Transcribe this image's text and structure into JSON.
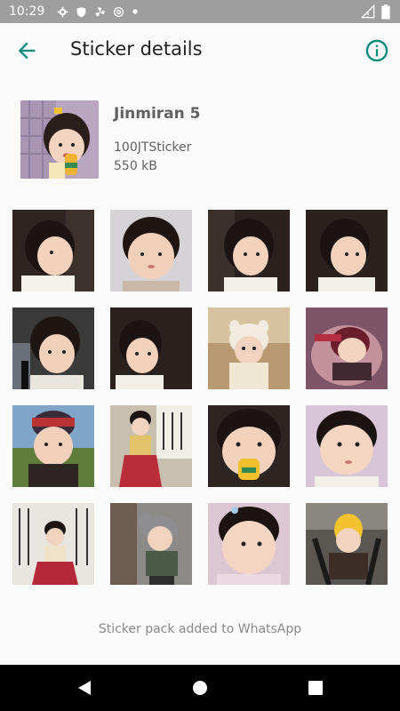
{
  "status_bar": {
    "time": "10:29",
    "left_icons": [
      "settings-icon",
      "shield-icon",
      "fan-icon",
      "at-icon",
      "dot-icon"
    ],
    "right_icons": [
      "signal-icon",
      "battery-icon"
    ]
  },
  "app_bar": {
    "title": "Sticker details",
    "back_icon": "arrow-back-icon",
    "info_icon": "info-icon",
    "accent_color": "#00897b"
  },
  "pack": {
    "name": "Jinmiran 5",
    "publisher": "100JTSticker",
    "size": "550 kB"
  },
  "stickers": [
    {
      "row": 1,
      "col": 1
    },
    {
      "row": 1,
      "col": 2
    },
    {
      "row": 1,
      "col": 3
    },
    {
      "row": 1,
      "col": 4
    },
    {
      "row": 2,
      "col": 1
    },
    {
      "row": 2,
      "col": 2
    },
    {
      "row": 2,
      "col": 3
    },
    {
      "row": 2,
      "col": 4
    },
    {
      "row": 3,
      "col": 1
    },
    {
      "row": 3,
      "col": 2
    },
    {
      "row": 3,
      "col": 3
    },
    {
      "row": 3,
      "col": 4
    },
    {
      "row": 4,
      "col": 1
    },
    {
      "row": 4,
      "col": 2
    },
    {
      "row": 4,
      "col": 3
    },
    {
      "row": 4,
      "col": 4
    }
  ],
  "footer": {
    "status_text": "Sticker pack added to WhatsApp"
  },
  "nav_bar": {
    "buttons": [
      "back-triangle-icon",
      "home-circle-icon",
      "recents-square-icon"
    ]
  }
}
